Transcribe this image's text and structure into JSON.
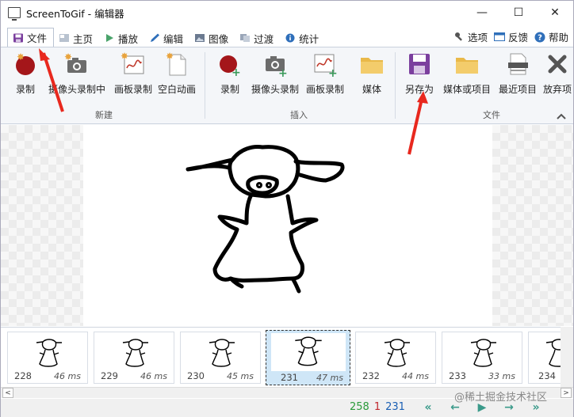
{
  "window": {
    "title": "ScreenToGif - 编辑器",
    "minimize": "—",
    "maximize": "☐",
    "close": "✕"
  },
  "tabs": [
    {
      "label": "文件",
      "icon": "save-icon"
    },
    {
      "label": "主页",
      "icon": "home-icon"
    },
    {
      "label": "播放",
      "icon": "play-icon"
    },
    {
      "label": "编辑",
      "icon": "pencil-icon"
    },
    {
      "label": "图像",
      "icon": "image-icon"
    },
    {
      "label": "过渡",
      "icon": "transition-icon"
    },
    {
      "label": "统计",
      "icon": "info-icon"
    }
  ],
  "tabs_right": {
    "options": "选项",
    "feedback": "反馈",
    "help": "帮助"
  },
  "ribbon": {
    "new_group": {
      "label": "新建",
      "buttons": [
        "录制",
        "摄像头录制中",
        "画板录制",
        "空白动画"
      ]
    },
    "insert_group": {
      "label": "插入",
      "buttons": [
        "录制",
        "摄像头录制",
        "画板录制",
        "媒体"
      ]
    },
    "file_group": {
      "label": "文件",
      "buttons": [
        "另存为",
        "媒体或项目",
        "最近项目",
        "放弃项"
      ]
    }
  },
  "frames": [
    {
      "number": "228",
      "delay": "46 ms"
    },
    {
      "number": "229",
      "delay": "46 ms"
    },
    {
      "number": "230",
      "delay": "45 ms"
    },
    {
      "number": "231",
      "delay": "47 ms",
      "selected": true
    },
    {
      "number": "232",
      "delay": "44 ms"
    },
    {
      "number": "233",
      "delay": "33 ms"
    },
    {
      "number": "234",
      "delay": ""
    }
  ],
  "status": {
    "total_frames": "258",
    "selected_count": "1",
    "current_frame": "231"
  },
  "colors": {
    "accent": "#1a5fb4",
    "record_red": "#a4161a",
    "save_purple": "#7b3f9e",
    "nav_teal": "#3a9a8a",
    "annotation_red": "#e8281e"
  },
  "watermark": "@稀土掘金技术社区"
}
